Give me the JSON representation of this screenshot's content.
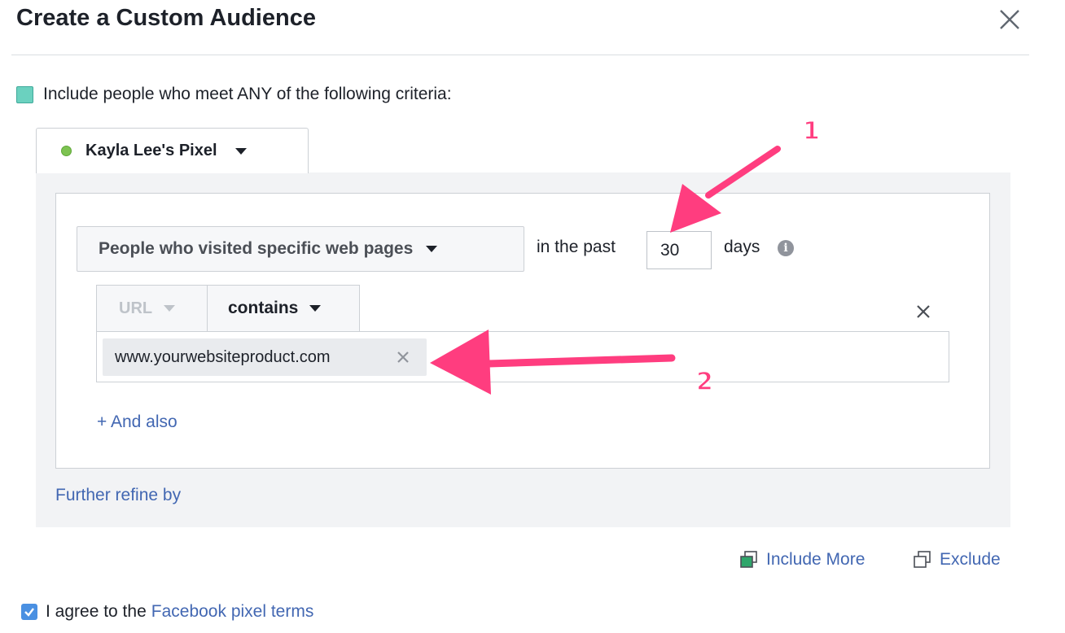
{
  "dialog": {
    "title": "Create a Custom Audience",
    "close_icon": "close-icon"
  },
  "criteria": {
    "include_text": "Include people who meet ANY of the following criteria:",
    "swatch_color": "#6bd1bf"
  },
  "pixel": {
    "name": "Kayla Lee's Pixel",
    "status_color": "#7dc351"
  },
  "rule": {
    "event_select": "People who visited specific web pages",
    "in_the_past": "in the past",
    "days_value": "30",
    "days_label": "days",
    "info_glyph": "i",
    "field_select": "URL",
    "operator_select": "contains",
    "url_tokens": [
      "www.yourwebsiteproduct.com"
    ],
    "and_also": "+ And also"
  },
  "further_refine": "Further refine by",
  "actions": {
    "include_more": "Include More",
    "exclude": "Exclude"
  },
  "agreement": {
    "checked": true,
    "prefix": "I agree to the",
    "link": "Facebook pixel terms"
  },
  "annotations": {
    "color": "#ff3d7f",
    "labels": [
      "1",
      "2"
    ]
  },
  "colors": {
    "link": "#4267b2",
    "panel_bg": "#f2f3f5",
    "border": "#ccd0d5"
  }
}
